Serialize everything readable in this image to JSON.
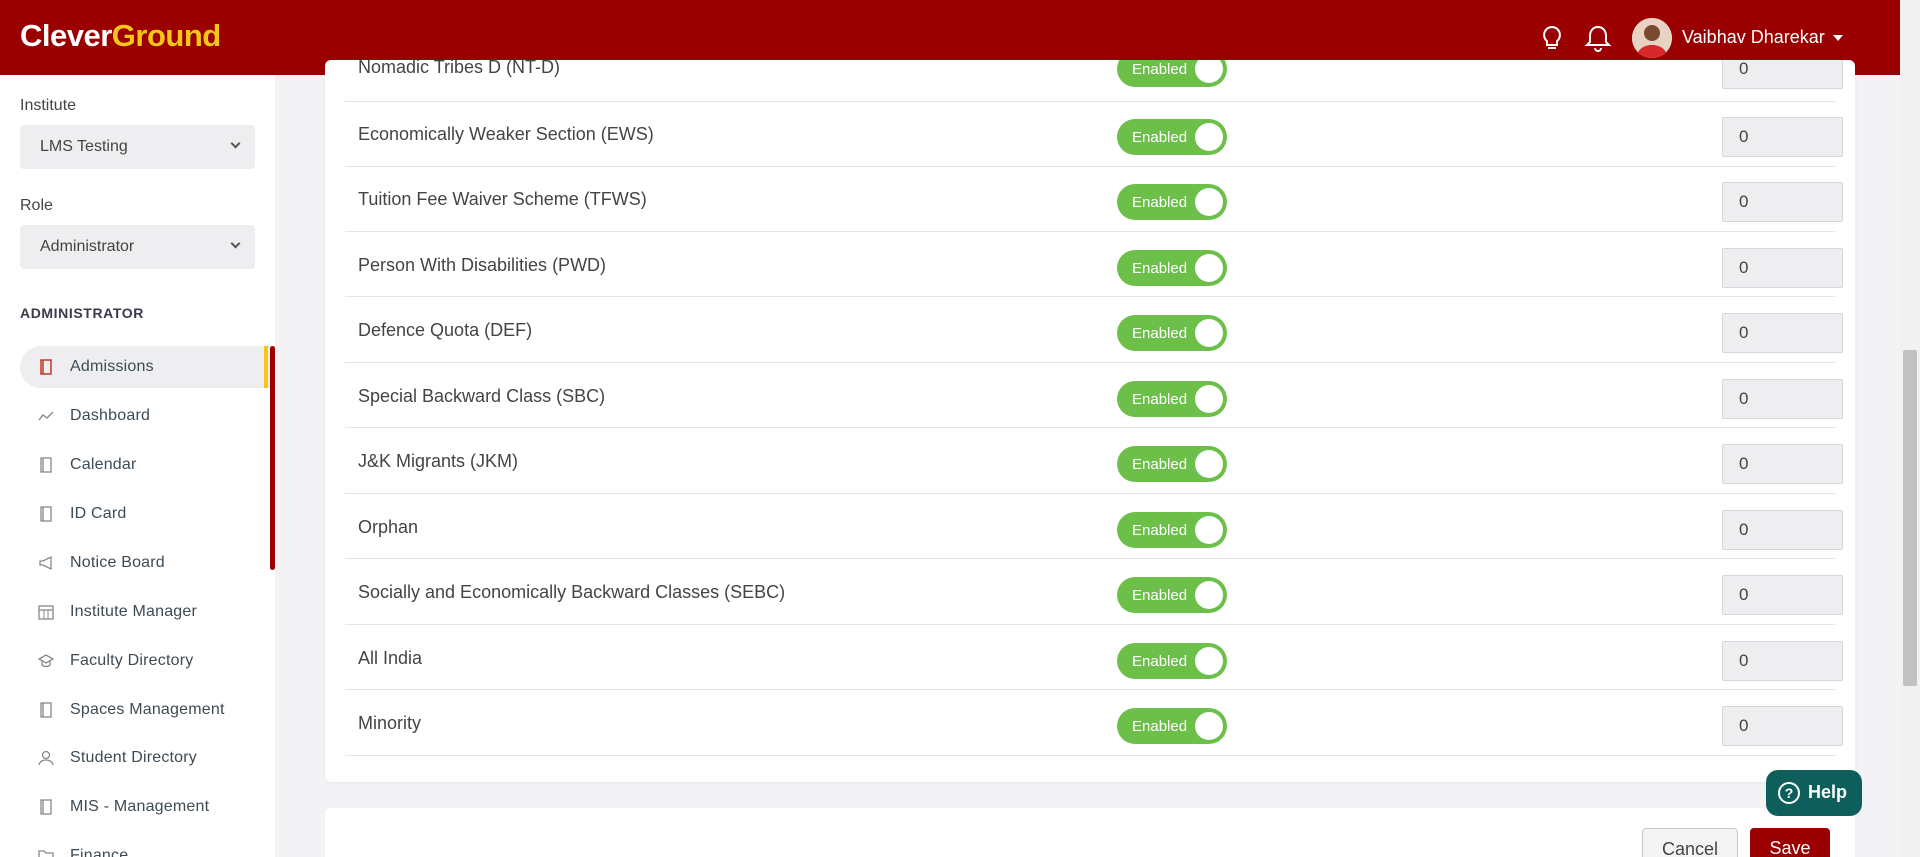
{
  "brand": {
    "part1": "Clever",
    "part2": "Ground",
    "color_primary": "#9a0000",
    "color_accent": "#f5c518"
  },
  "header": {
    "user_name": "Vaibhav Dharekar",
    "icons": [
      "bulb-icon",
      "bell-icon",
      "avatar"
    ]
  },
  "sidebar": {
    "institute_label": "Institute",
    "institute_value": "LMS Testing",
    "role_label": "Role",
    "role_value": "Administrator",
    "section_heading": "ADMINISTRATOR",
    "items": [
      {
        "label": "Admissions",
        "icon": "notebook-icon",
        "active": true
      },
      {
        "label": "Dashboard",
        "icon": "trend-line-icon"
      },
      {
        "label": "Calendar",
        "icon": "notebook-icon"
      },
      {
        "label": "ID Card",
        "icon": "notebook-icon"
      },
      {
        "label": "Notice Board",
        "icon": "megaphone-icon"
      },
      {
        "label": "Institute Manager",
        "icon": "calendar-grid-icon"
      },
      {
        "label": "Faculty Directory",
        "icon": "graduation-cap-icon"
      },
      {
        "label": "Spaces Management",
        "icon": "notebook-icon"
      },
      {
        "label": "Student Directory",
        "icon": "user-icon"
      },
      {
        "label": "MIS - Management",
        "icon": "notebook-icon"
      },
      {
        "label": "Finance",
        "icon": "folder-icon"
      }
    ]
  },
  "categories": {
    "status_color": "#6cc04a",
    "rows": [
      {
        "name": "Nomadic Tribes D (NT-D)",
        "status": "Enabled",
        "value": "0"
      },
      {
        "name": "Economically Weaker Section (EWS)",
        "status": "Enabled",
        "value": "0"
      },
      {
        "name": "Tuition Fee Waiver Scheme (TFWS)",
        "status": "Enabled",
        "value": "0"
      },
      {
        "name": "Person With Disabilities (PWD)",
        "status": "Enabled",
        "value": "0"
      },
      {
        "name": "Defence Quota (DEF)",
        "status": "Enabled",
        "value": "0"
      },
      {
        "name": "Special Backward Class (SBC)",
        "status": "Enabled",
        "value": "0"
      },
      {
        "name": "J&K Migrants (JKM)",
        "status": "Enabled",
        "value": "0"
      },
      {
        "name": "Orphan",
        "status": "Enabled",
        "value": "0"
      },
      {
        "name": "Socially and Economically Backward Classes (SEBC)",
        "status": "Enabled",
        "value": "0"
      },
      {
        "name": "All India",
        "status": "Enabled",
        "value": "0"
      },
      {
        "name": "Minority",
        "status": "Enabled",
        "value": "0"
      }
    ]
  },
  "actions": {
    "cancel_label": "Cancel",
    "save_label": "Save"
  },
  "help": {
    "label": "Help"
  }
}
